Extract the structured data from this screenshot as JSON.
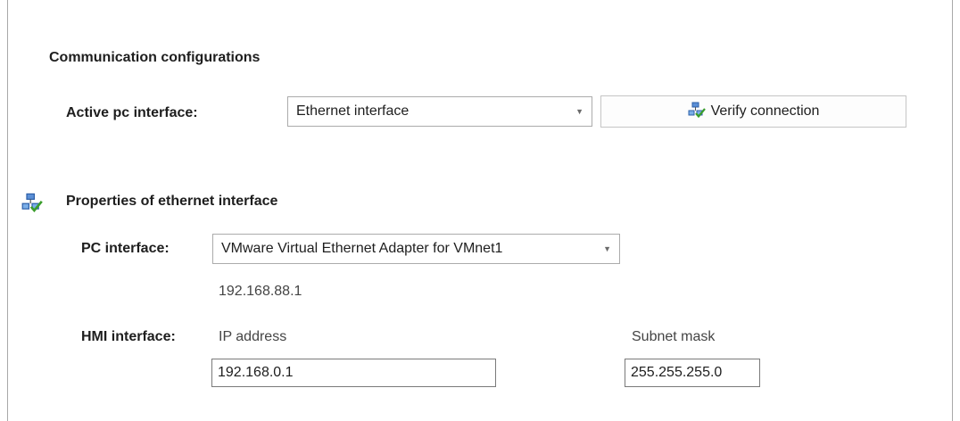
{
  "section": {
    "title": "Communication configurations"
  },
  "active_interface": {
    "label": "Active pc interface:",
    "selected": "Ethernet interface",
    "verify_button": "Verify connection",
    "verify_icon": "network-check-icon"
  },
  "properties": {
    "title": "Properties of ethernet interface",
    "icon": "network-check-icon",
    "pc_interface_label": "PC interface:",
    "pc_interface_selected": "VMware Virtual Ethernet Adapter for VMnet1",
    "pc_ip": "192.168.88.1",
    "hmi_interface_label": "HMI interface:",
    "ip_address_label": "IP address",
    "ip_address_value": "192.168.0.1",
    "subnet_mask_label": "Subnet mask",
    "subnet_mask_value": "255.255.255.0"
  }
}
